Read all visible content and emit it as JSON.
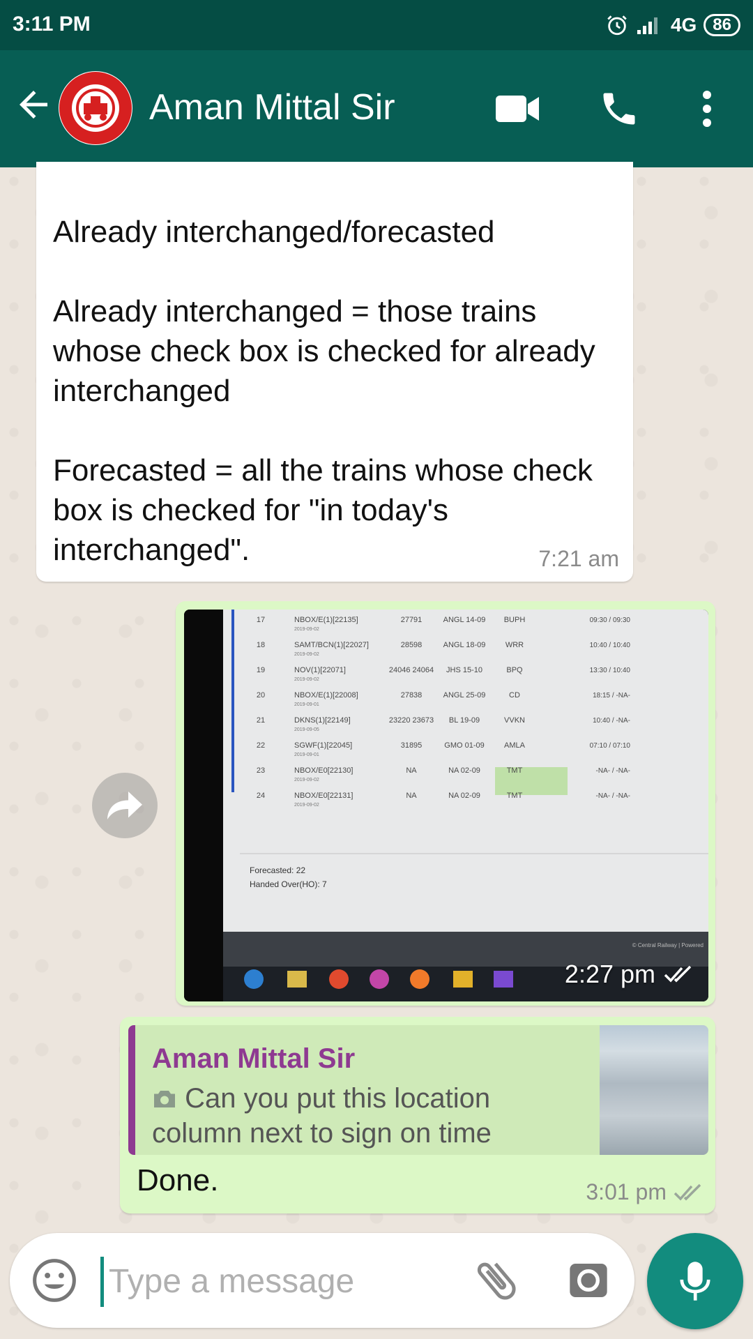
{
  "status_bar": {
    "time": "3:11 PM",
    "network": "4G",
    "battery": "86"
  },
  "header": {
    "contact_name": "Aman Mittal Sir"
  },
  "messages": [
    {
      "direction": "incoming",
      "text": "Already interchanged/forecasted\n\nAlready interchanged = those trains whose check box is checked for already interchanged\n\nForecasted = all the trains whose check box is checked for \"in today's interchanged\".",
      "time": "7:21 am"
    },
    {
      "direction": "outgoing",
      "type": "photo",
      "time": "2:27 pm"
    },
    {
      "direction": "outgoing",
      "quoted_name": "Aman Mittal Sir",
      "quoted_text": "Can you put this location column next to sign on time",
      "text": "Done.",
      "time": "3:01 pm"
    }
  ],
  "photo_table": {
    "rows": [
      {
        "no": "17",
        "train": "NBOX/E(1)[22135]",
        "date": "2019-09-02",
        "loco": "27791",
        "dep": "ANGL 14-09",
        "stn": "BUPH",
        "times": "09:30 / 09:30"
      },
      {
        "no": "18",
        "train": "SAMT/BCN(1)[22027]",
        "date": "2019-09-02",
        "loco": "28598",
        "dep": "ANGL 18-09",
        "stn": "WRR",
        "times": "10:40 / 10:40"
      },
      {
        "no": "19",
        "train": "NOV(1)[22071]",
        "date": "2019-09-02",
        "loco": "24046 24064",
        "dep": "JHS 15-10",
        "stn": "BPQ",
        "times": "13:30 / 10:40"
      },
      {
        "no": "20",
        "train": "NBOX/E(1)[22008]",
        "date": "2019-09-01",
        "loco": "27838",
        "dep": "ANGL 25-09",
        "stn": "CD",
        "times": "18:15 / -NA-"
      },
      {
        "no": "21",
        "train": "DKNS(1)[22149]",
        "date": "2019-09-05",
        "loco": "23220 23673",
        "dep": "BL 19-09",
        "stn": "VVKN",
        "times": "10:40 / -NA-"
      },
      {
        "no": "22",
        "train": "SGWF(1)[22045]",
        "date": "2019-09-01",
        "loco": "31895",
        "dep": "GMO 01-09",
        "stn": "AMLA",
        "times": "07:10 / 07:10"
      },
      {
        "no": "23",
        "train": "NBOX/E0[22130]",
        "date": "2019-09-02",
        "loco": "NA",
        "dep": "NA 02-09",
        "stn": "TMT",
        "times": "-NA- / -NA-"
      },
      {
        "no": "24",
        "train": "NBOX/E0[22131]",
        "date": "2019-09-02",
        "loco": "NA",
        "dep": "NA 02-09",
        "stn": "TMT",
        "times": "-NA- / -NA-"
      }
    ],
    "forecasted": "Forecasted: 22",
    "handed_over": "Handed Over(HO): 7",
    "footer_credit": "© Central Railway | Powered"
  },
  "input": {
    "placeholder": "Type a message"
  },
  "colors": {
    "header": "#075e54",
    "status_bar": "#054d44",
    "outgoing_bubble": "#dcf8c6",
    "accent": "#128c7e",
    "quote_name": "#8e3a91"
  },
  "icons": [
    "back-arrow-icon",
    "video-call-icon",
    "phone-icon",
    "more-options-icon",
    "forward-icon",
    "camera-icon",
    "emoji-icon",
    "attach-icon",
    "mic-icon",
    "double-check-icon",
    "alarm-icon",
    "signal-icon"
  ]
}
